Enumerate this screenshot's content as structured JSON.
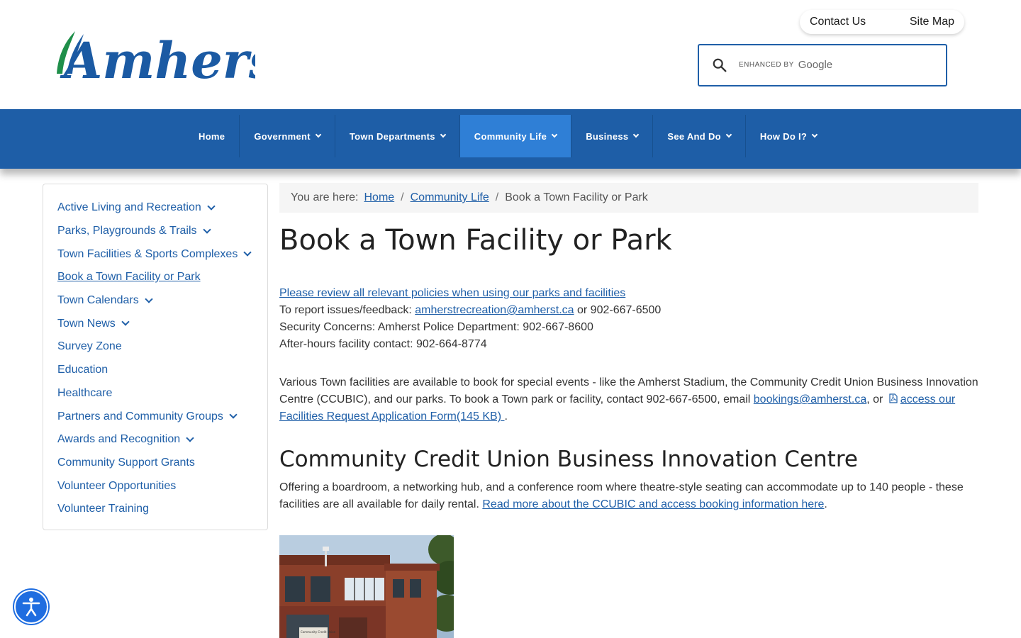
{
  "header": {
    "logo_text": "Amherst",
    "top_links": [
      "Contact Us",
      "Site Map"
    ],
    "search": {
      "placeholder": "",
      "watermark_prefix": "ENHANCED BY",
      "watermark_brand": "Google"
    }
  },
  "nav": {
    "items": [
      {
        "label": "Home",
        "has_dropdown": false,
        "active": false
      },
      {
        "label": "Government",
        "has_dropdown": true,
        "active": false
      },
      {
        "label": "Town Departments",
        "has_dropdown": true,
        "active": false
      },
      {
        "label": "Community Life",
        "has_dropdown": true,
        "active": true
      },
      {
        "label": "Business",
        "has_dropdown": true,
        "active": false
      },
      {
        "label": "See And Do",
        "has_dropdown": true,
        "active": false
      },
      {
        "label": "How Do I?",
        "has_dropdown": true,
        "active": false
      }
    ]
  },
  "sidebar": {
    "items": [
      {
        "label": "Active Living and Recreation",
        "expandable": true
      },
      {
        "label": "Parks, Playgrounds & Trails",
        "expandable": true
      },
      {
        "label": "Town Facilities & Sports Complexes",
        "expandable": true
      },
      {
        "label": "Book a Town Facility or Park",
        "expandable": false,
        "current": true
      },
      {
        "label": "Town Calendars",
        "expandable": true
      },
      {
        "label": "Town News",
        "expandable": true
      },
      {
        "label": "Survey Zone",
        "expandable": false
      },
      {
        "label": "Education",
        "expandable": false
      },
      {
        "label": "Healthcare",
        "expandable": false
      },
      {
        "label": "Partners and Community Groups",
        "expandable": true
      },
      {
        "label": "Awards and Recognition",
        "expandable": true
      },
      {
        "label": "Community Support Grants",
        "expandable": false
      },
      {
        "label": "Volunteer Opportunities",
        "expandable": false
      },
      {
        "label": "Volunteer Training",
        "expandable": false
      }
    ]
  },
  "breadcrumb": {
    "prefix": "You are here:",
    "home": "Home",
    "section": "Community Life",
    "current": "Book a Town Facility or Park",
    "separator": "/"
  },
  "main": {
    "title": "Book a Town Facility or Park",
    "policies_link": "Please review all relevant policies when using our parks and facilities",
    "report_prefix": "To report issues/feedback:",
    "report_email": "amherstrecreation@amherst.ca",
    "report_suffix": "or 902-667-6500",
    "security": "Security Concerns: Amherst Police Department: 902-667-8600",
    "after_hours": "After-hours facility contact: 902-664-8774",
    "para_text": "Various Town facilities are available to book for special events - like the Amherst Stadium, the Community Credit Union Business Innovation Centre (CCUBIC), and our parks. To book a Town park or facility, contact 902-667-6500, email",
    "para_email": "bookings@amherst.ca",
    "para_or": ", or",
    "para_form_link_a": "access our",
    "para_form_link_b": "Facilities Request Application Form(145 KB)",
    "para_end": ".",
    "section_heading": "Community Credit Union Business Innovation Centre",
    "section_text": "Offering a boardroom, a networking hub, and a conference room where theatre-style seating can accommodate up to 140 people - these facilities are all available for daily rental.",
    "section_link": "Read more about the CCUBIC and access booking information here",
    "section_end": ".",
    "photo_sign_text": "Community Credit Union"
  },
  "colors": {
    "nav_bg": "#1e5ea7",
    "nav_active": "#2f7fd6",
    "link": "#1f5fa8",
    "logo_blue": "#1b5aa3",
    "logo_green": "#1f8f4a",
    "accessibility_btn": "#1f6de0"
  },
  "icons": {
    "search": "magnifier-icon",
    "pdf": "pdf-file-icon",
    "accessibility": "accessibility-person-icon"
  }
}
